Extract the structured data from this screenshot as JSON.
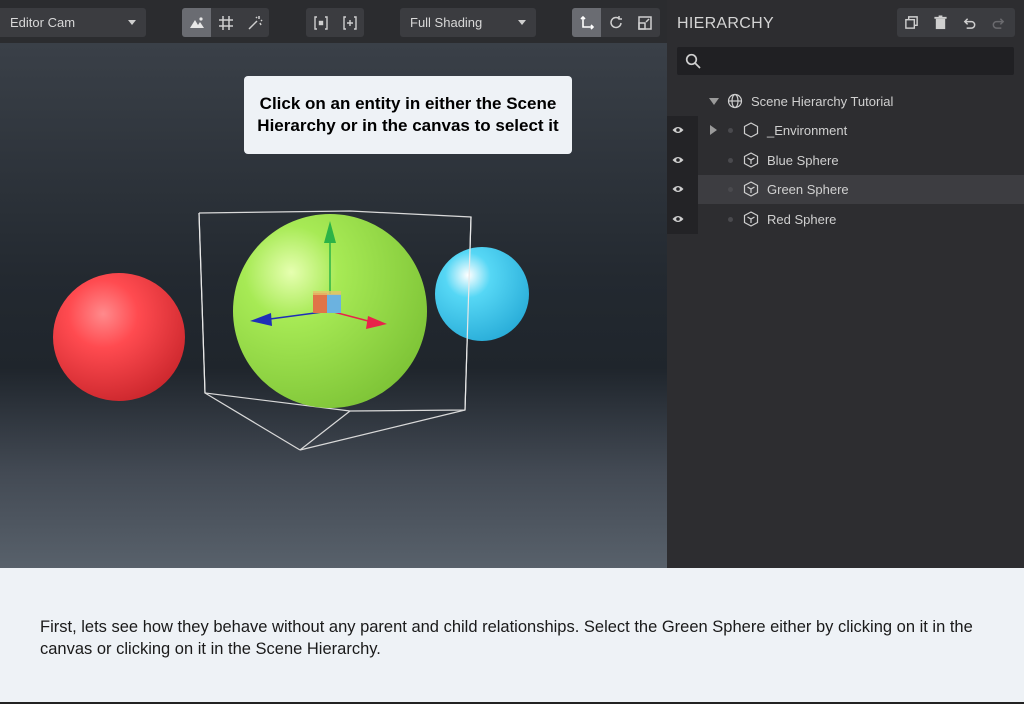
{
  "toolbar": {
    "camera_dropdown": "Editor Cam",
    "shading_dropdown": "Full Shading",
    "view_icons": [
      "landscape-icon",
      "grid-icon",
      "magic-wand-icon"
    ],
    "bounds_icons": [
      "frame-bounds-icon",
      "frame-selection-icon"
    ],
    "transform_icons": [
      "move-axis-icon",
      "rotate-icon",
      "scale-icon"
    ]
  },
  "viewport": {
    "callout": "Click on an entity in either the Scene Hierarchy or in the canvas to select it",
    "entities": [
      {
        "name": "Red Sphere",
        "color": "#ff4a50"
      },
      {
        "name": "Green Sphere",
        "color": "#9ae64a",
        "selected": true
      },
      {
        "name": "Blue Sphere",
        "color": "#4ed2f2"
      }
    ],
    "gizmo_colors": {
      "y": "#2bb347",
      "x": "#e8234a",
      "z": "#1e2fb8"
    }
  },
  "hierarchy": {
    "title": "HIERARCHY",
    "tool_icons": [
      "duplicate-icon",
      "trash-icon",
      "undo-icon",
      "redo-icon"
    ],
    "search_icon": "search-icon",
    "root": {
      "label": "Scene Hierarchy Tutorial",
      "icon": "globe-icon",
      "expanded": true
    },
    "items": [
      {
        "label": "_Environment",
        "icon": "hexagon-icon",
        "collapsed": true
      },
      {
        "label": "Blue Sphere",
        "icon": "entity-icon"
      },
      {
        "label": "Green Sphere",
        "icon": "entity-icon",
        "selected": true
      },
      {
        "label": "Red Sphere",
        "icon": "entity-icon"
      }
    ]
  },
  "caption": {
    "text": "First, lets see how they behave without any parent and child relationships. Select the Green Sphere either by clicking on it in the canvas or clicking on it in the Scene Hierarchy."
  }
}
